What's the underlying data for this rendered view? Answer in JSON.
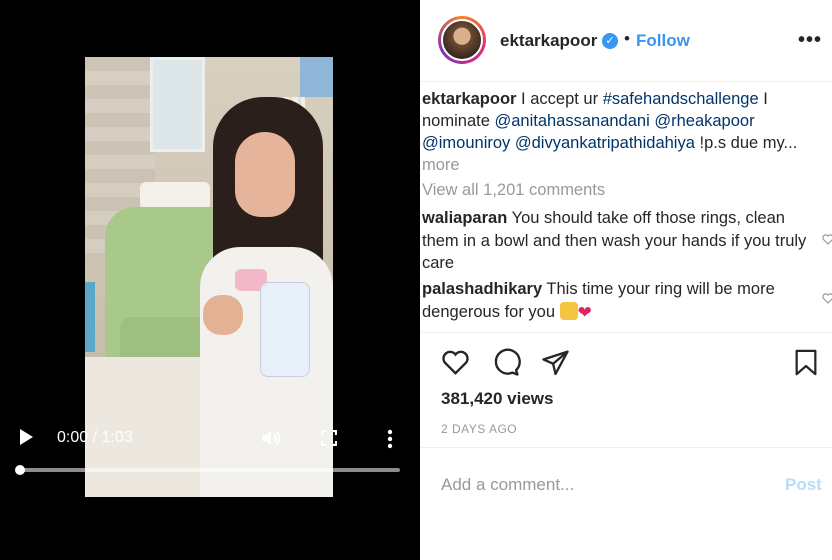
{
  "video": {
    "time": "0:00 / 1:03",
    "progress": 0.0,
    "icons": [
      "play-icon",
      "volume-icon",
      "fullscreen-icon",
      "kebab-menu-icon"
    ]
  },
  "post": {
    "username": "ektarkapoor",
    "verified": true,
    "follow_label": "Follow",
    "more_menu": "•••",
    "caption": {
      "user": "ektarkapoor",
      "part1": " I accept ur ",
      "hashtag": "#safehandschallenge",
      "part2": " I nominate ",
      "mention1": "@anitahassanandani",
      "mention2": "@rheakapoor",
      "mention3": "@imouniroy",
      "mention4": "@divyankatripathidahiya",
      "part3": " !p.s due my... ",
      "more": "more"
    },
    "view_all": "View all 1,201 comments",
    "comments": [
      {
        "user": "waliaparan",
        "text": " You should take off those rings, clean them in a bowl and then wash your hands if you truly care"
      },
      {
        "user": "palashadhikary",
        "text": " This time your ring will be more dengerous for you"
      }
    ],
    "views": "381,420 views",
    "date": "2 DAYS AGO",
    "comment_placeholder": "Add a comment...",
    "post_label": "Post"
  },
  "colors": {
    "link": "#3897f0",
    "text": "#262626",
    "muted": "#999999",
    "tag": "#003569",
    "post_disabled": "#b2dffc"
  }
}
